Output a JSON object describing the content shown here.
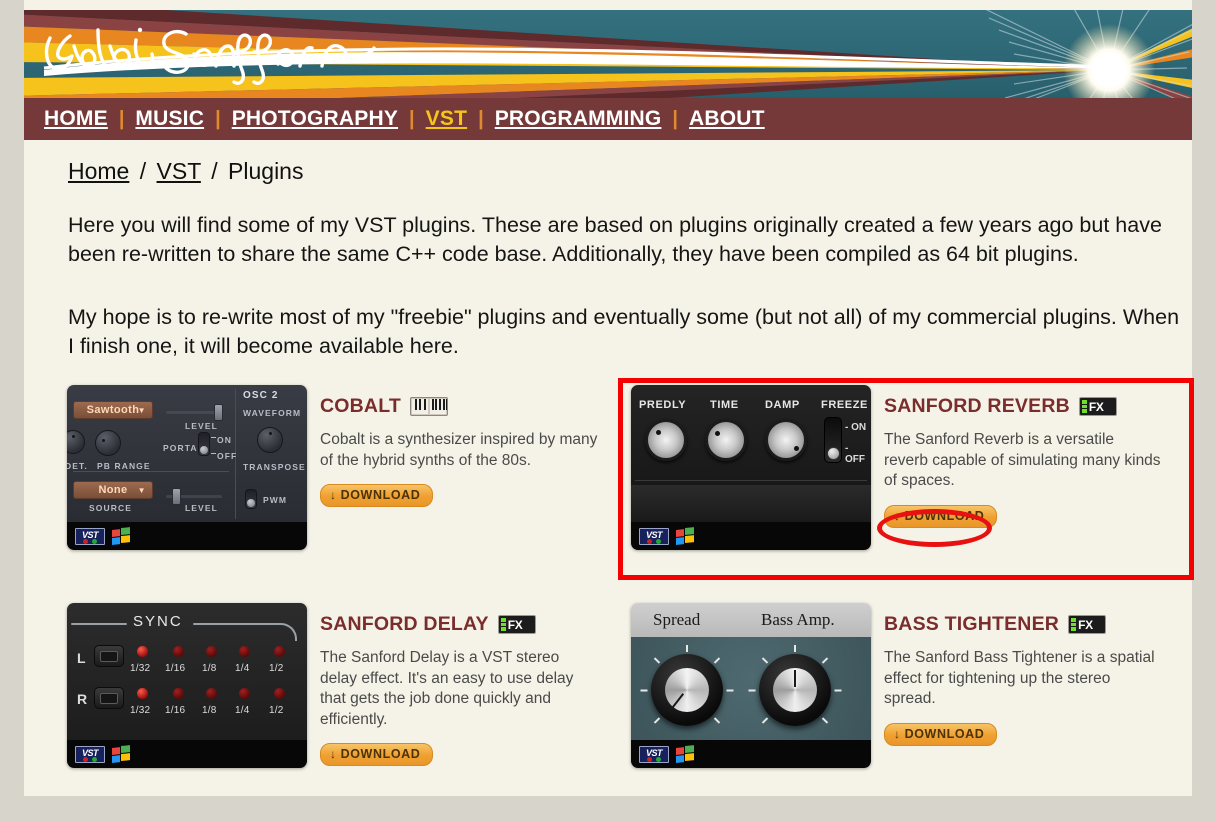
{
  "site": {
    "logo_text": "leslie Sanford",
    "banner_colors": {
      "teal": "#2e6b7a",
      "maroon": "#76393a",
      "orange": "#e8871f",
      "yellow": "#f6c21c",
      "dark_maroon": "#5e2a2b"
    }
  },
  "nav": {
    "separator": "|",
    "items": [
      {
        "label": "HOME",
        "active": false
      },
      {
        "label": "MUSIC",
        "active": false
      },
      {
        "label": "PHOTOGRAPHY",
        "active": false
      },
      {
        "label": "VST",
        "active": true
      },
      {
        "label": "PROGRAMMING",
        "active": false
      },
      {
        "label": "ABOUT",
        "active": false
      }
    ]
  },
  "breadcrumb": {
    "items": [
      {
        "label": "Home",
        "link": true
      },
      {
        "label": "VST",
        "link": true
      },
      {
        "label": "Plugins",
        "link": false
      }
    ],
    "separator": "/"
  },
  "intro": {
    "paragraph1": "Here you will find some of my VST plugins. These are based on plugins originally created a few years ago but have been re-written to share the same C++ code base. Additionally, they have been compiled as 64 bit plugins.",
    "paragraph2": "My hope is to re-write most of my \"freebie\" plugins and eventually some (but not all) of my commercial plugins. When I finish one, it will become available here."
  },
  "download_button": {
    "label": "DOWNLOAD",
    "arrow_icon": "↓"
  },
  "plugins": [
    {
      "name": "COBALT",
      "badge": "keyboard",
      "description": "Cobalt is a synthesizer inspired by many of the hybrid synths of the 80s.",
      "screenshot": {
        "type": "cobalt-synth",
        "labels": [
          "OSC 2",
          "WAVEFORM",
          "TRANSPOSE",
          "PWM",
          "LEVEL",
          "PORTA.",
          "ON",
          "OFF",
          "DET.",
          "PB RANGE",
          "SOURCE",
          "LEVEL"
        ],
        "combo1": "Sawtooth",
        "combo2": "None"
      }
    },
    {
      "name": "SANFORD REVERB",
      "badge": "fx",
      "description": "The Sanford Reverb is a versatile reverb capable of simulating many kinds of spaces.",
      "screenshot": {
        "type": "reverb",
        "knobs": [
          "PREDLY",
          "TIME",
          "DAMP"
        ],
        "switch_label": "FREEZE",
        "switch_on": "- ON",
        "switch_off": "- OFF"
      },
      "highlighted": true
    },
    {
      "name": "SANFORD DELAY",
      "badge": "fx",
      "description": "The Sanford Delay is a VST stereo delay effect. It's an easy to use delay that gets the job done quickly and efficiently.",
      "screenshot": {
        "type": "delay",
        "section": "SYNC",
        "channels": [
          "L",
          "R"
        ],
        "divisions": [
          "1/32",
          "1/16",
          "1/8",
          "1/4",
          "1/2"
        ]
      }
    },
    {
      "name": "BASS TIGHTENER",
      "badge": "fx",
      "description": "The Sanford Bass Tightener is a spatial effect for tightening up the stereo spread.",
      "screenshot": {
        "type": "bass-tightener",
        "knob_labels": [
          "Spread",
          "Bass Amp."
        ]
      }
    }
  ],
  "annotations": {
    "highlight_rect_color": "#f50000",
    "highlight_ellipse_color": "#e81010",
    "highlight_target": "SANFORD REVERB",
    "ellipse_target": "DOWNLOAD"
  },
  "platform_icons": {
    "vst": "VST",
    "windows": "windows-flag"
  }
}
